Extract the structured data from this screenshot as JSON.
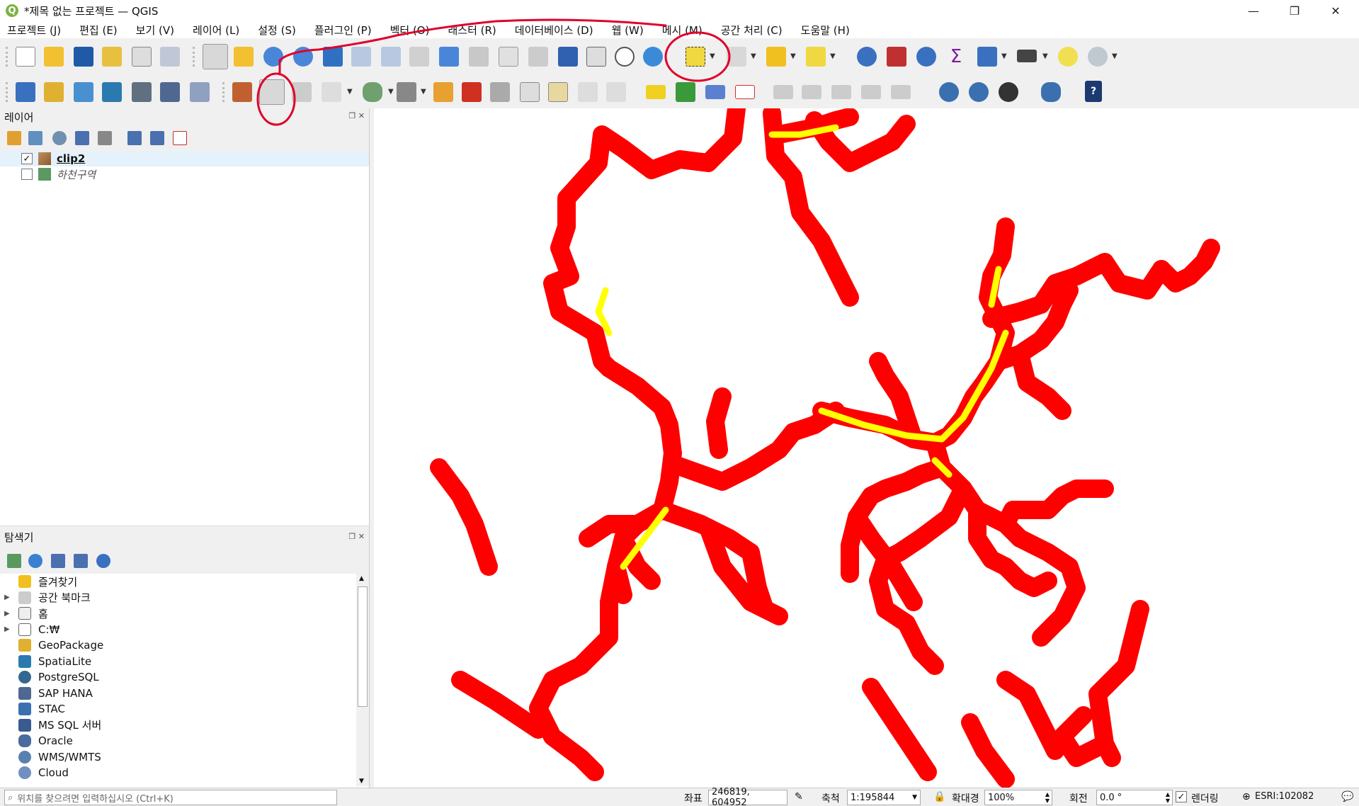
{
  "window": {
    "title": "*제목 없는 프로젝트 — QGIS",
    "minimize": "—",
    "restore": "❐",
    "close": "✕"
  },
  "menu": [
    "프로젝트 (J)",
    "편집 (E)",
    "보기 (V)",
    "레이어 (L)",
    "설정 (S)",
    "플러그인 (P)",
    "벡터 (O)",
    "래스터 (R)",
    "데이터베이스 (D)",
    "웹 (W)",
    "메시 (M)",
    "공간 처리 (C)",
    "도움말 (H)"
  ],
  "layers": {
    "title": "레이어",
    "items": [
      {
        "name": "clip2",
        "checked": "✓",
        "style": "bold-underline"
      },
      {
        "name": "하천구역",
        "checked": "",
        "style": "italic"
      }
    ]
  },
  "browser": {
    "title": "탐색기",
    "items": [
      {
        "label": "즐겨찾기",
        "icon": "star-icon",
        "expandable": false
      },
      {
        "label": "공간 북마크",
        "icon": "bookmark-icon",
        "expandable": true
      },
      {
        "label": "홈",
        "icon": "home-icon",
        "expandable": true
      },
      {
        "label": "C:₩",
        "icon": "folder-icon",
        "expandable": true
      },
      {
        "label": "GeoPackage",
        "icon": "geopackage-icon",
        "expandable": false
      },
      {
        "label": "SpatiaLite",
        "icon": "spatialite-icon",
        "expandable": false
      },
      {
        "label": "PostgreSQL",
        "icon": "postgresql-icon",
        "expandable": false
      },
      {
        "label": "SAP HANA",
        "icon": "sap-hana-icon",
        "expandable": false
      },
      {
        "label": "STAC",
        "icon": "stac-icon",
        "expandable": false
      },
      {
        "label": "MS SQL 서버",
        "icon": "mssql-icon",
        "expandable": false
      },
      {
        "label": "Oracle",
        "icon": "oracle-icon",
        "expandable": false
      },
      {
        "label": "WMS/WMTS",
        "icon": "wms-icon",
        "expandable": false
      },
      {
        "label": "Cloud",
        "icon": "cloud-icon",
        "expandable": false
      }
    ]
  },
  "status": {
    "search_placeholder": "위치를 찾으려면 입력하십시오 (Ctrl+K)",
    "coord_label": "좌표",
    "coord_value": "246819, 604952",
    "scale_label": "축척",
    "scale_value": "1:195844",
    "magnifier_label": "확대경",
    "magnifier_value": "100%",
    "rotation_label": "회전",
    "rotation_value": "0.0 °",
    "render_label": "렌더링",
    "render_checked": "✓",
    "crs": "ESRI:102082"
  },
  "colors": {
    "river_outer": "#ff0000",
    "river_inner": "#ffff00",
    "annotation": "#e0002a"
  }
}
